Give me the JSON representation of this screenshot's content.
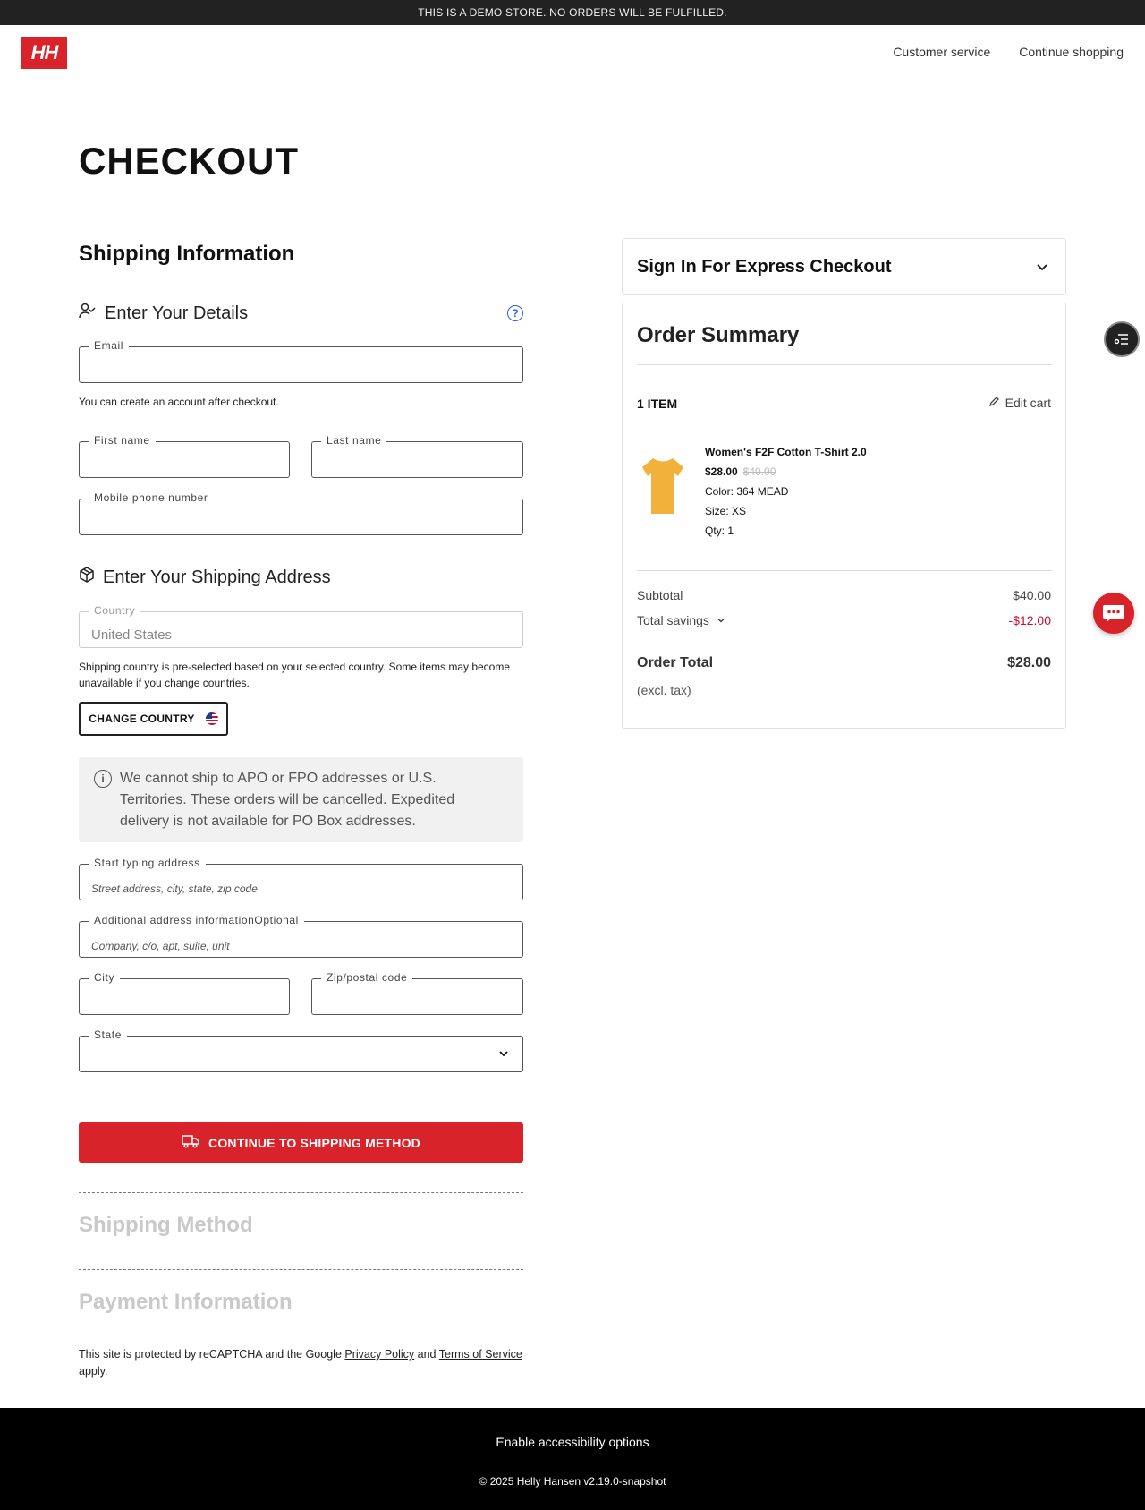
{
  "banner": "THIS IS A DEMO STORE. NO ORDERS WILL BE FULFILLED.",
  "header": {
    "logo": "HH",
    "links": [
      "Customer service",
      "Continue shopping"
    ]
  },
  "page_title": "CHECKOUT",
  "shipping": {
    "title": "Shipping Information",
    "details_heading": "Enter Your Details",
    "email_label": "Email",
    "account_note": "You can create an account after checkout.",
    "first_name_label": "First name",
    "last_name_label": "Last name",
    "phone_label": "Mobile phone number",
    "address_heading": "Enter Your Shipping Address",
    "country_label": "Country",
    "country_value": "United States",
    "country_note": "Shipping country is pre-selected based on your selected country. Some items may become unavailable if you change countries.",
    "change_country": "CHANGE COUNTRY",
    "info_text": "We cannot ship to APO or FPO addresses or U.S. Territories. These orders will be cancelled. Expedited delivery is not available for PO Box addresses.",
    "address_label": "Start typing address",
    "address_placeholder": "Street address, city, state, zip code",
    "additional_label": "Additional address informationOptional",
    "additional_placeholder": "Company, c/o, apt, suite, unit",
    "city_label": "City",
    "zip_label": "Zip/postal code",
    "state_label": "State",
    "continue_button": "CONTINUE TO SHIPPING METHOD"
  },
  "steps": {
    "shipping_method": "Shipping Method",
    "payment": "Payment Information"
  },
  "recaptcha": {
    "prefix": "This site is protected by reCAPTCHA and the Google",
    "privacy": "Privacy Policy",
    "and": "and",
    "terms": "Terms of Service",
    "suffix": "apply."
  },
  "express": {
    "title": "Sign In For Express Checkout"
  },
  "summary": {
    "title": "Order Summary",
    "item_count": "1 ITEM",
    "edit_cart": "Edit cart",
    "product": {
      "name": "Women's F2F Cotton T-Shirt 2.0",
      "price": "$28.00",
      "original_price": "$40.00",
      "color": "Color: 364 MEAD",
      "size": "Size: XS",
      "qty": "Qty: 1",
      "image_color": "#f2b13b"
    },
    "subtotal_label": "Subtotal",
    "subtotal_value": "$40.00",
    "savings_label": "Total savings",
    "savings_value": "-$12.00",
    "total_label": "Order Total",
    "total_value": "$28.00",
    "tax_note": "(excl. tax)"
  },
  "footer": {
    "accessibility": "Enable accessibility options",
    "copyright": "© 2025 Helly Hansen v2.19.0-snapshot"
  },
  "colors": {
    "brand_red": "#d9232b",
    "savings_red": "#c8102e",
    "dark": "#222222"
  }
}
